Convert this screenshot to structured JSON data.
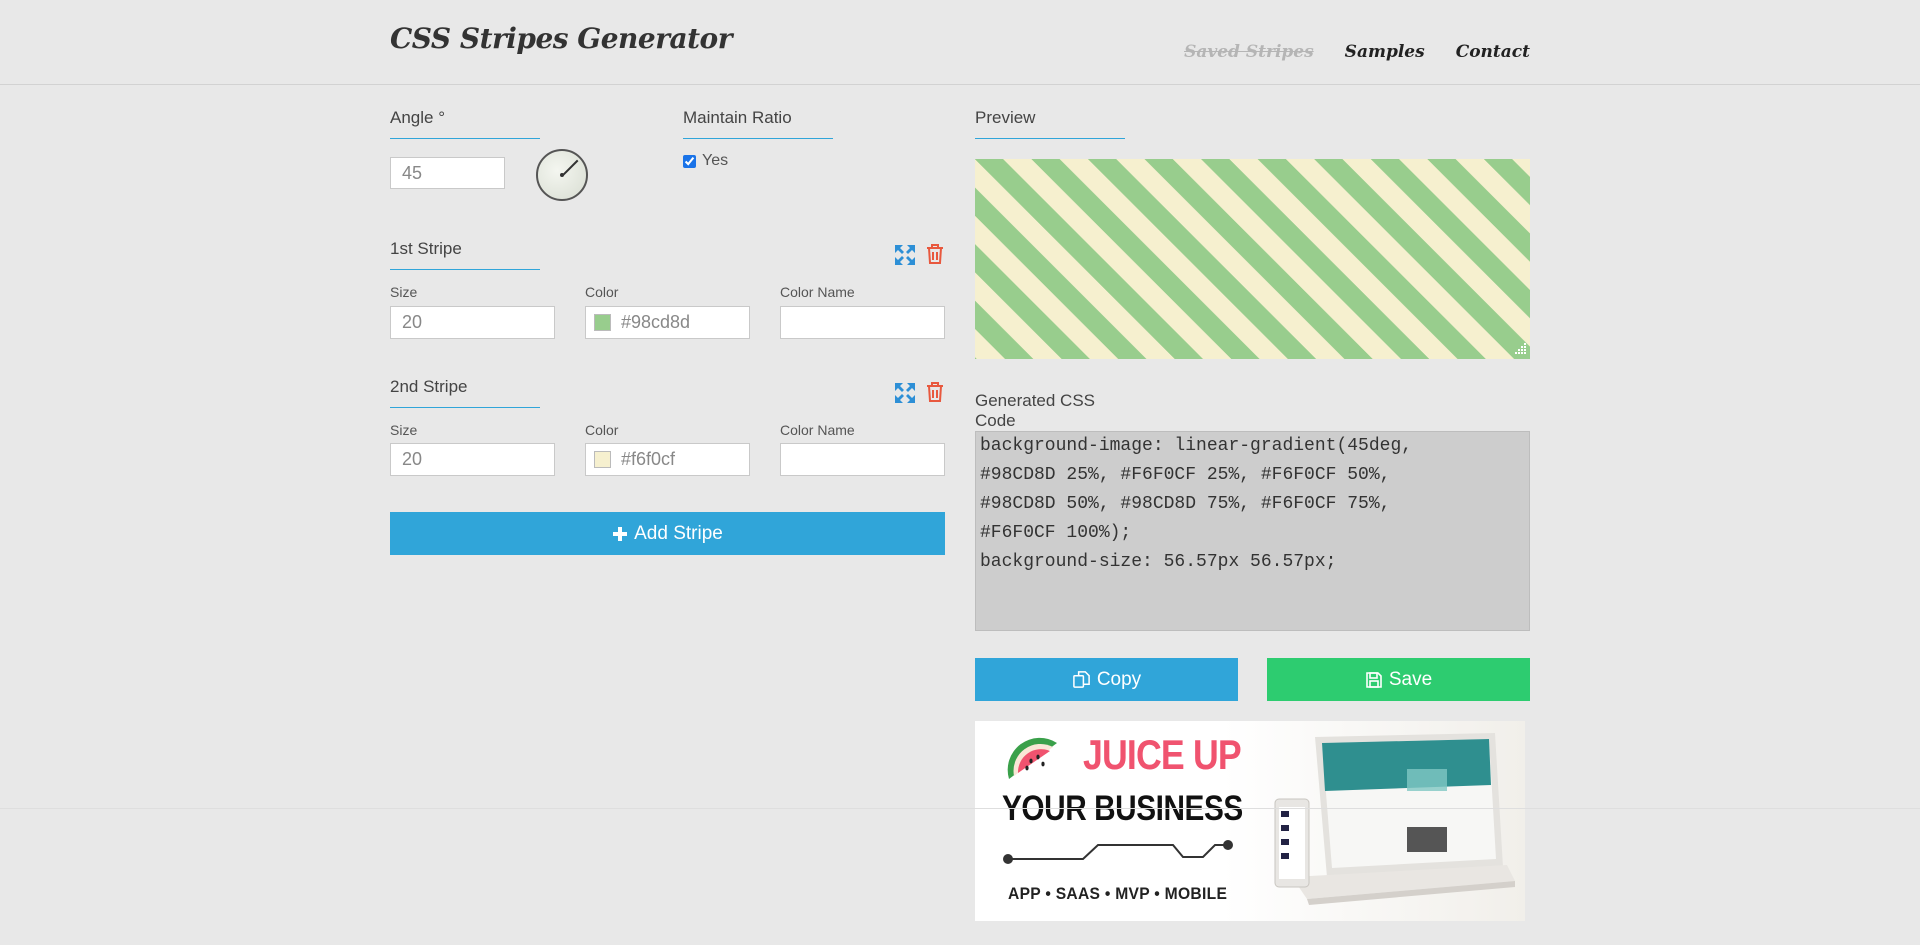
{
  "header": {
    "logo": "CSS Stripes Generator",
    "nav": [
      "Saved Stripes",
      "Samples",
      "Contact"
    ]
  },
  "angle": {
    "label": "Angle °",
    "value": "45"
  },
  "ratio": {
    "label": "Maintain Ratio",
    "checkbox_label": "Yes",
    "checked": true
  },
  "stripes": [
    {
      "title": "1st Stripe",
      "size_label": "Size",
      "size": "20",
      "color_label": "Color",
      "color": "#98cd8d",
      "name_label": "Color Name",
      "name": ""
    },
    {
      "title": "2nd Stripe",
      "size_label": "Size",
      "size": "20",
      "color_label": "Color",
      "color": "#f6f0cf",
      "name_label": "Color Name",
      "name": ""
    }
  ],
  "add_stripe_label": "Add Stripe",
  "preview": {
    "label": "Preview",
    "colors": [
      "#98cd8d",
      "#f6f0cf"
    ]
  },
  "code": {
    "label": "Generated CSS Code",
    "text": "background-image: linear-gradient(45deg,\n#98CD8D 25%, #F6F0CF 25%, #F6F0CF 50%,\n#98CD8D 50%, #98CD8D 75%, #F6F0CF 75%,\n#F6F0CF 100%);\nbackground-size: 56.57px 56.57px;"
  },
  "actions": {
    "copy_label": "Copy",
    "save_label": "Save"
  },
  "ad": {
    "headline1": "JUICE UP",
    "headline2": "YOUR BUSINESS",
    "tagline": "APP • SAAS • MVP • MOBILE"
  },
  "colors": {
    "accent_blue": "#30a5d9",
    "save_green": "#2dcc70",
    "delete_red": "#e8583e"
  }
}
